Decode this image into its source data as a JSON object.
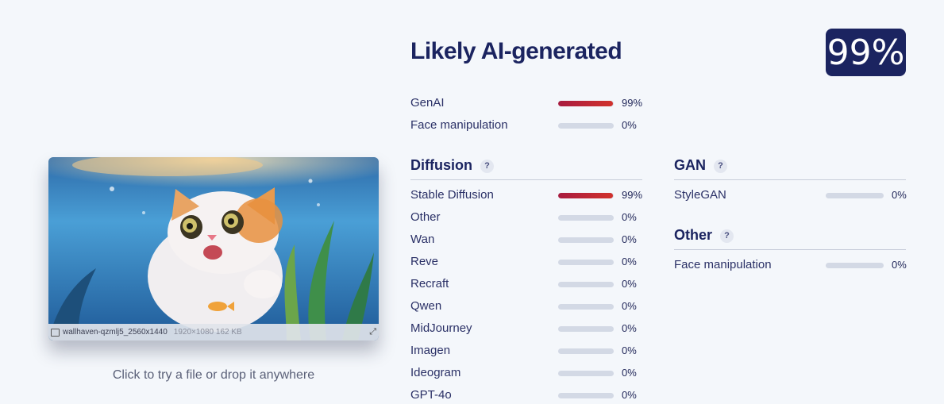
{
  "verdict": {
    "title": "Likely AI-generated",
    "score": "99%"
  },
  "summary": [
    {
      "label": "GenAI",
      "value": 0.99,
      "pct": "99%"
    },
    {
      "label": "Face manipulation",
      "value": 0.0,
      "pct": "0%"
    }
  ],
  "diffusion": {
    "heading": "Diffusion",
    "help": "?",
    "items": [
      {
        "label": "Stable Diffusion",
        "value": 0.99,
        "pct": "99%"
      },
      {
        "label": "Other",
        "value": 0.0,
        "pct": "0%"
      },
      {
        "label": "Wan",
        "value": 0.0,
        "pct": "0%"
      },
      {
        "label": "Reve",
        "value": 0.0,
        "pct": "0%"
      },
      {
        "label": "Recraft",
        "value": 0.0,
        "pct": "0%"
      },
      {
        "label": "Qwen",
        "value": 0.0,
        "pct": "0%"
      },
      {
        "label": "MidJourney",
        "value": 0.0,
        "pct": "0%"
      },
      {
        "label": "Imagen",
        "value": 0.0,
        "pct": "0%"
      },
      {
        "label": "Ideogram",
        "value": 0.0,
        "pct": "0%"
      },
      {
        "label": "GPT-4o",
        "value": 0.0,
        "pct": "0%"
      }
    ]
  },
  "gan": {
    "heading": "GAN",
    "help": "?",
    "items": [
      {
        "label": "StyleGAN",
        "value": 0.0,
        "pct": "0%"
      }
    ]
  },
  "other": {
    "heading": "Other",
    "help": "?",
    "items": [
      {
        "label": "Face manipulation",
        "value": 0.0,
        "pct": "0%"
      }
    ]
  },
  "preview": {
    "filename": "wallhaven-qzmlj5_2560x1440",
    "meta": "1920×1080 162 KB",
    "icons": [
      "image-icon",
      "expand-icon"
    ]
  },
  "drop_hint": "Click to try a file or drop it anywhere",
  "colors": {
    "accent": "#1b2460",
    "bar_fill": "#c0262f",
    "bar_track": "#d3d9e5"
  }
}
